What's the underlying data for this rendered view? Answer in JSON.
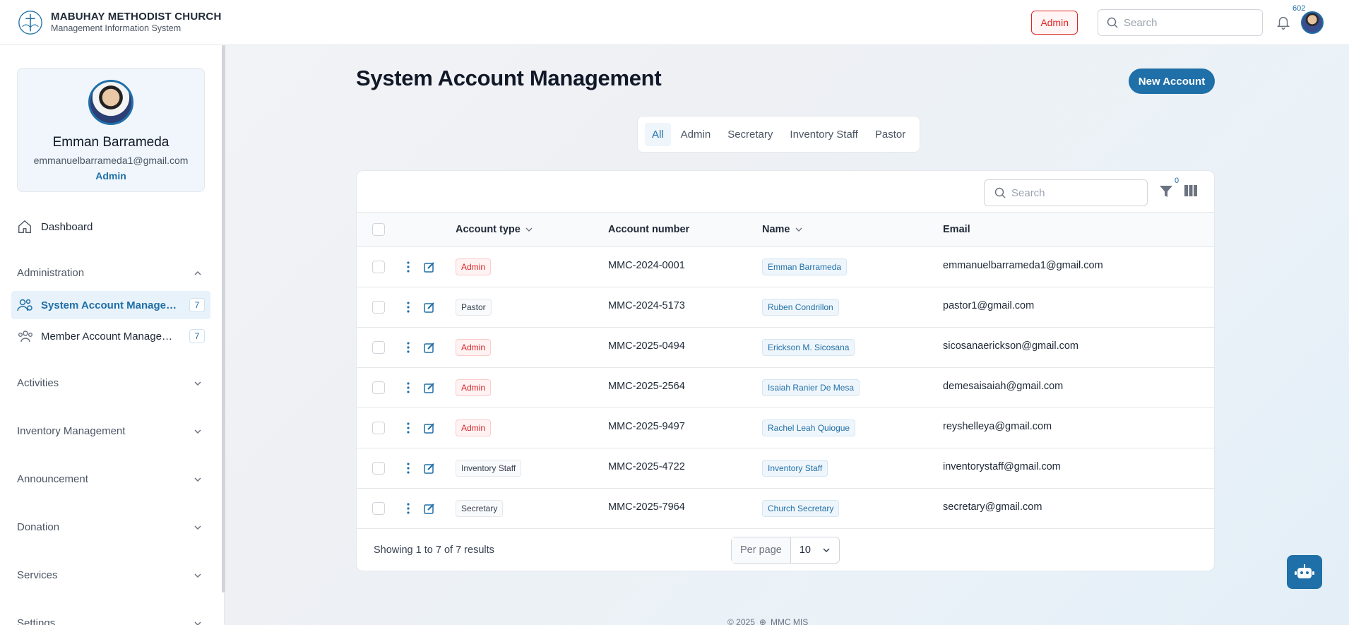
{
  "header": {
    "org_name": "MABUHAY METHODIST CHURCH",
    "system_name": "Management Information System",
    "role_chip": "Admin",
    "search_placeholder": "Search",
    "notification_count": "602"
  },
  "profile": {
    "name": "Emman Barrameda",
    "email": "emmanuelbarrameda1@gmail.com",
    "role": "Admin"
  },
  "sidebar": {
    "dashboard": "Dashboard",
    "groups": [
      {
        "label": "Administration"
      },
      {
        "label": "Activities"
      },
      {
        "label": "Inventory Management"
      },
      {
        "label": "Announcement"
      },
      {
        "label": "Donation"
      },
      {
        "label": "Services"
      },
      {
        "label": "Settings"
      }
    ],
    "admin_items": [
      {
        "label": "System Account Management",
        "count": "7"
      },
      {
        "label": "Member Account Management",
        "count": "7"
      }
    ]
  },
  "page": {
    "title": "System Account Management",
    "new_button": "New Account",
    "tabs": [
      "All",
      "Admin",
      "Secretary",
      "Inventory Staff",
      "Pastor"
    ]
  },
  "table": {
    "search_placeholder": "Search",
    "filter_count": "0",
    "columns": [
      "Account type",
      "Account number",
      "Name",
      "Email"
    ],
    "rows": [
      {
        "type": "Admin",
        "number": "MMC-2024-0001",
        "name": "Emman Barrameda",
        "email": "emmanuelbarrameda1@gmail.com"
      },
      {
        "type": "Pastor",
        "number": "MMC-2024-5173",
        "name": "Ruben Condrillon",
        "email": "pastor1@gmail.com"
      },
      {
        "type": "Admin",
        "number": "MMC-2025-0494",
        "name": "Erickson M. Sicosana",
        "email": "sicosanaerickson@gmail.com"
      },
      {
        "type": "Admin",
        "number": "MMC-2025-2564",
        "name": "Isaiah Ranier De Mesa",
        "email": "demesaisaiah@gmail.com"
      },
      {
        "type": "Admin",
        "number": "MMC-2025-9497",
        "name": "Rachel Leah Quiogue",
        "email": "reyshelleya@gmail.com"
      },
      {
        "type": "Inventory Staff",
        "number": "MMC-2025-4722",
        "name": "Inventory Staff",
        "email": "inventorystaff@gmail.com"
      },
      {
        "type": "Secretary",
        "number": "MMC-2025-7964",
        "name": "Church Secretary",
        "email": "secretary@gmail.com"
      }
    ],
    "showing": "Showing 1 to 7 of 7 results",
    "per_page_label": "Per page",
    "per_page_value": "10"
  },
  "footer": {
    "year": "© 2025",
    "brand": "MMC MIS"
  },
  "colors": {
    "primary": "#1f6fa8",
    "danger": "#dc2626"
  }
}
